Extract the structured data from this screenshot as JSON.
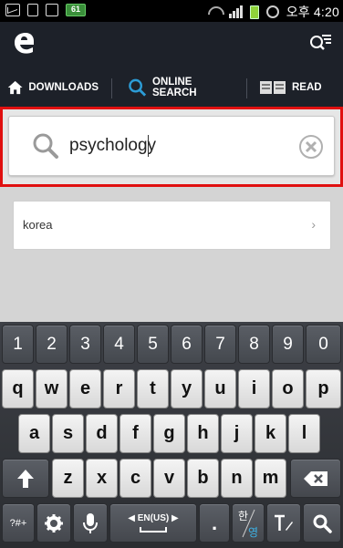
{
  "status_bar": {
    "battery_level_text": "61",
    "clock": "오후 4:20"
  },
  "app_bar": {
    "logo_icon": "app-logo-e",
    "menu_icon": "search-menu-icon"
  },
  "tabs": [
    {
      "label": "DOWNLOADS",
      "icon": "home-icon"
    },
    {
      "label": "ONLINE SEARCH",
      "icon": "search-icon"
    },
    {
      "label": "READ",
      "icon": "book-icon"
    }
  ],
  "search": {
    "value": "psychology",
    "clear_icon": "clear-icon"
  },
  "suggestions": [
    {
      "label": "korea",
      "chevron": "›"
    }
  ],
  "keyboard": {
    "numbers": [
      "1",
      "2",
      "3",
      "4",
      "5",
      "6",
      "7",
      "8",
      "9",
      "0"
    ],
    "row1": [
      "q",
      "w",
      "e",
      "r",
      "t",
      "y",
      "u",
      "i",
      "o",
      "p"
    ],
    "row2": [
      "a",
      "s",
      "d",
      "f",
      "g",
      "h",
      "j",
      "k",
      "l"
    ],
    "row3": [
      "z",
      "x",
      "c",
      "v",
      "b",
      "n",
      "m"
    ],
    "symbols_label": "?#+",
    "space_label": "◀ EN(US) ▶",
    "period_label": ".",
    "hangul_top": "한",
    "hangul_bottom": "영"
  },
  "colors": {
    "tab_indicator": "#2c9cd6",
    "highlight_border": "#e01010",
    "appbar_bg": "#1d2129"
  }
}
